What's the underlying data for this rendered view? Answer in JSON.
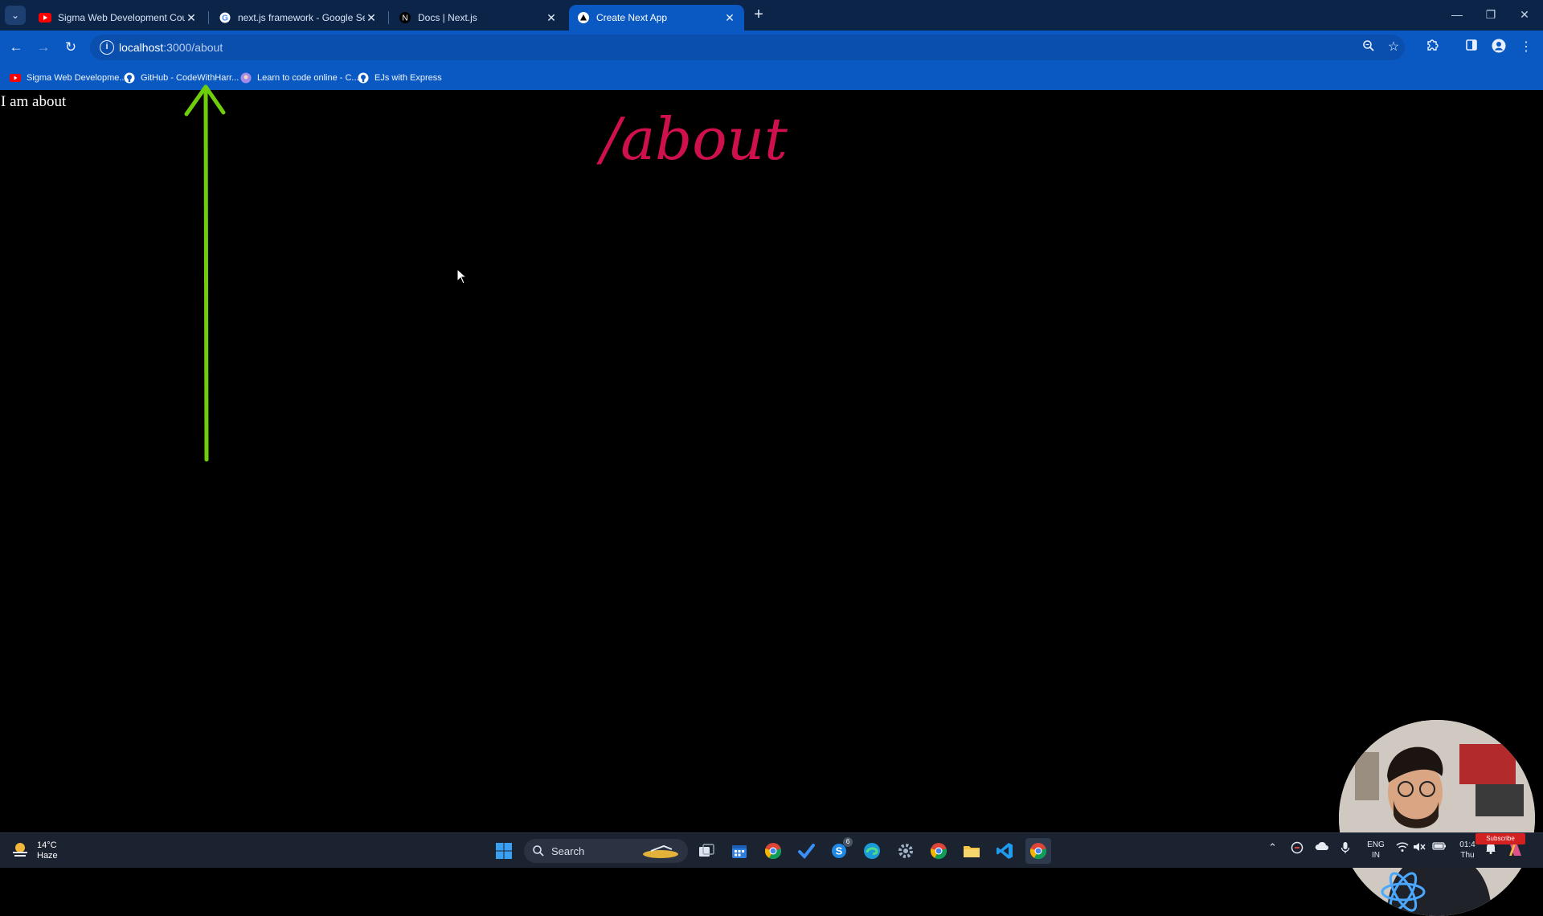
{
  "browser": {
    "tabs": [
      {
        "title": "Sigma Web Development Course - W",
        "favicon": "youtube-icon",
        "active": false
      },
      {
        "title": "next.js framework - Google Search",
        "favicon": "google-icon",
        "active": false
      },
      {
        "title": "Docs | Next.js",
        "favicon": "nextjs-icon",
        "active": false
      },
      {
        "title": "Create Next App",
        "favicon": "vercel-triangle-icon",
        "active": true
      }
    ],
    "url_host": "localhost",
    "url_rest": ":3000/about",
    "bookmarks": [
      {
        "label": "Sigma Web Developme...",
        "icon": "youtube-icon"
      },
      {
        "label": "GitHub - CodeWithHarr...",
        "icon": "github-icon"
      },
      {
        "label": "Learn to code online - C...",
        "icon": "codedamn-icon"
      },
      {
        "label": "EJs with Express",
        "icon": "github-icon"
      }
    ]
  },
  "page": {
    "body_text": "I am about",
    "annotation": "/about",
    "annotation_color": "#d0104c",
    "arrow_color": "#6fce0c"
  },
  "taskbar": {
    "weather_temp": "14°C",
    "weather_desc": "Haze",
    "search_label": "Search",
    "skype_badge": "6",
    "lang_top": "ENG",
    "lang_bottom": "IN",
    "time": "01:4",
    "day": "Thu",
    "subscribe_label": "Subscribe"
  },
  "colors": {
    "titlebar": "#0b2447",
    "toolbar": "#0a59c2",
    "page_bg": "#000000",
    "taskbar": "#1c2330"
  }
}
